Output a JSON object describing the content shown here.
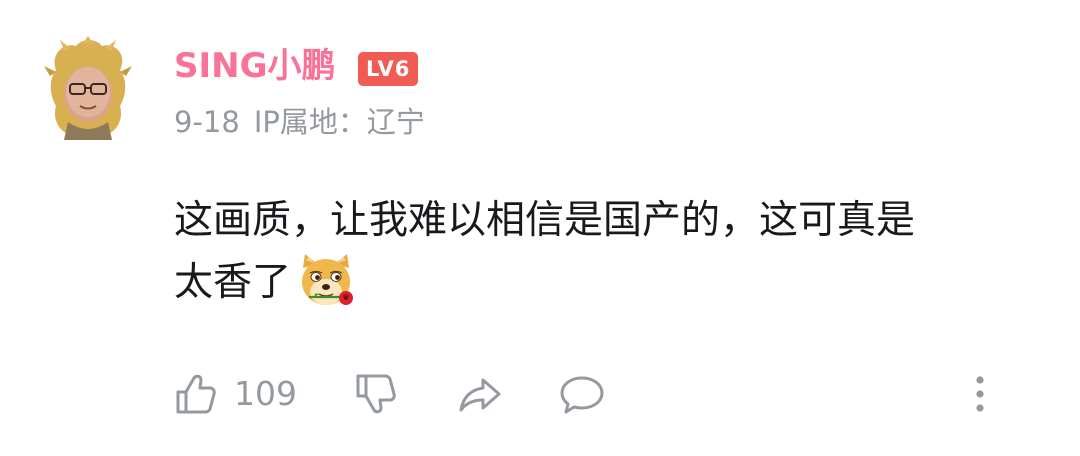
{
  "comment": {
    "user": {
      "name": "SING小鹏",
      "level": "LV6",
      "avatar_icon": "avatar-elf-character",
      "name_color": "#fb7299",
      "level_color": "#f05b53"
    },
    "meta": {
      "date": "9-18",
      "ip_location": "IP属地：辽宁"
    },
    "text_line1": "这画质，让我难以相信是国产的，这可真是",
    "text_line2": "太香了",
    "emoji_icon": "doge-with-rose-emoji",
    "actions": {
      "like_icon": "thumbs-up-icon",
      "like_count": "109",
      "dislike_icon": "thumbs-down-icon",
      "share_icon": "share-icon",
      "reply_icon": "reply-bubble-icon",
      "more_icon": "more-vertical-icon"
    }
  }
}
